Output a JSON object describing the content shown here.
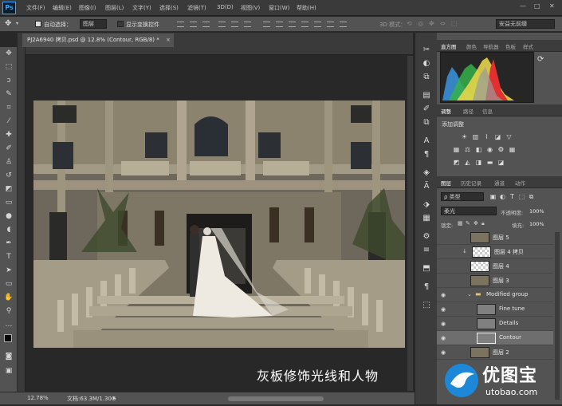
{
  "app": {
    "logo": "Ps"
  },
  "menu": [
    "文件(F)",
    "编辑(E)",
    "图像(I)",
    "图层(L)",
    "文字(Y)",
    "选择(S)",
    "滤镜(T)",
    "3D(D)",
    "视图(V)",
    "窗口(W)",
    "帮助(H)"
  ],
  "window_controls": {
    "minimize": "—",
    "restore": "□",
    "close": "✕"
  },
  "options": {
    "auto_select_label": "自动选择：",
    "auto_select_value": "图层",
    "show_transform_label": "显示变换控件",
    "mode_3d_label": "3D 模式：",
    "workspace": "安益无前缀"
  },
  "document": {
    "tab_title": "PJ2A6940 拷贝.psd @ 12.8% (Contour, RGB/8) *",
    "close_glyph": "×"
  },
  "status": {
    "zoom": "12.78%",
    "doc_info": "文档:63.3M/1.30G"
  },
  "caption": "灰板修饰光线和人物",
  "panels": {
    "histogram_tabs": [
      "直方图",
      "颜色",
      "导航器",
      "色板",
      "样式"
    ],
    "adjust_tabs": [
      "调整",
      "路径",
      "信息"
    ],
    "adjust_add_label": "添加调整",
    "layers_tabs": [
      "图层",
      "历史记录",
      "通道",
      "动作"
    ],
    "filter_kind": "ρ 类型",
    "blend_mode": "柔光",
    "opacity_label": "不透明度:",
    "opacity_value": "100%",
    "lock_label": "锁定:",
    "fill_label": "填充:",
    "fill_value": "100%",
    "layers": [
      {
        "name": "图层 5",
        "visible": false,
        "type": "photo"
      },
      {
        "name": "图层 4 拷贝",
        "visible": false,
        "type": "checker"
      },
      {
        "name": "图层 4",
        "visible": false,
        "type": "checker"
      },
      {
        "name": "图层 3",
        "visible": false,
        "type": "photo"
      },
      {
        "name": "Modified group",
        "visible": true,
        "type": "group"
      },
      {
        "name": "Fine tune",
        "visible": true,
        "type": "gray"
      },
      {
        "name": "Details",
        "visible": true,
        "type": "gray"
      },
      {
        "name": "Contour",
        "visible": true,
        "type": "gray",
        "selected": true
      },
      {
        "name": "图层 2",
        "visible": true,
        "type": "photo"
      }
    ]
  },
  "watermark": {
    "brand": "优图宝",
    "url": "utobao.com"
  },
  "colors": {
    "accent": "#31a8ff",
    "panel": "#535353",
    "dark": "#282828",
    "watermark_blue": "#1e88d8"
  }
}
